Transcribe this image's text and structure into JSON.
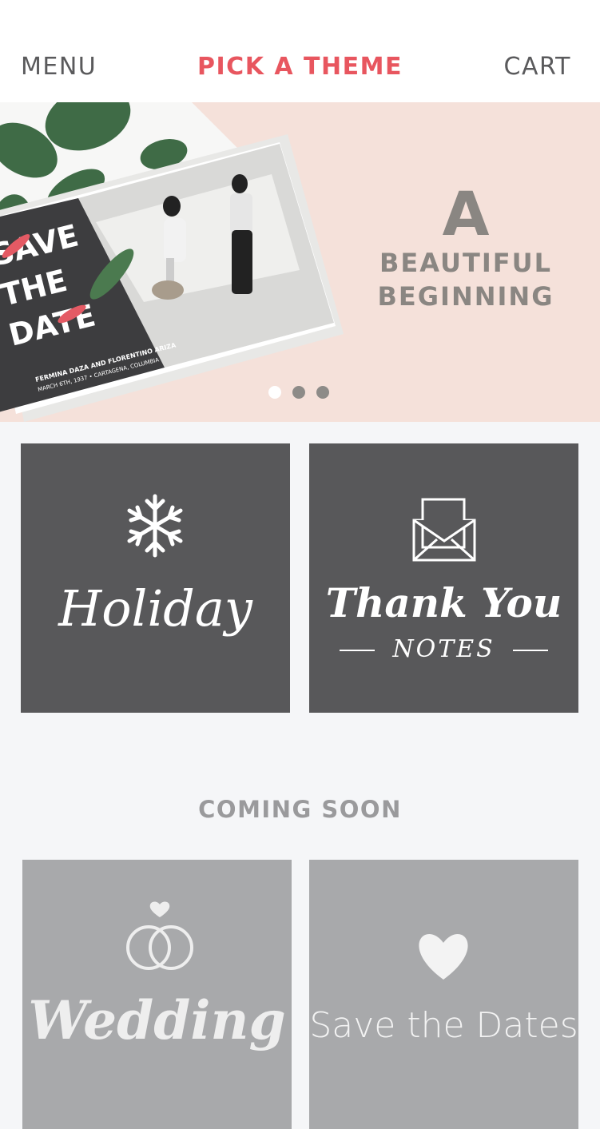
{
  "header": {
    "menu_label": "MENU",
    "title": "PICK A THEME",
    "cart_label": "CART"
  },
  "hero": {
    "headline": "A",
    "subline_1": "BEAUTIFUL",
    "subline_2": "BEGINNING",
    "card_text_1": "SAVE",
    "card_text_2": "THE",
    "card_text_3": "DATE",
    "card_names": "FERMINA DAZA AND FLORENTINO ARIZA",
    "card_details": "MARCH 6TH, 1937 • CARTAGENA, COLUMBIA",
    "slides": {
      "count": 3,
      "active_index": 0
    }
  },
  "themes": [
    {
      "label": "Holiday",
      "icon": "snowflake-icon"
    },
    {
      "label": "Thank You",
      "sublabel": "NOTES",
      "icon": "envelope-icon"
    }
  ],
  "coming_soon": {
    "heading": "COMING SOON",
    "items": [
      {
        "label": "Wedding",
        "icon": "rings-icon"
      },
      {
        "label": "Save the Dates",
        "icon": "heart-icon"
      }
    ]
  },
  "colors": {
    "accent": "#e8565f",
    "tile_dark": "#58585a",
    "tile_grey": "#a8a9ab",
    "hero_bg": "#f5e1da"
  }
}
